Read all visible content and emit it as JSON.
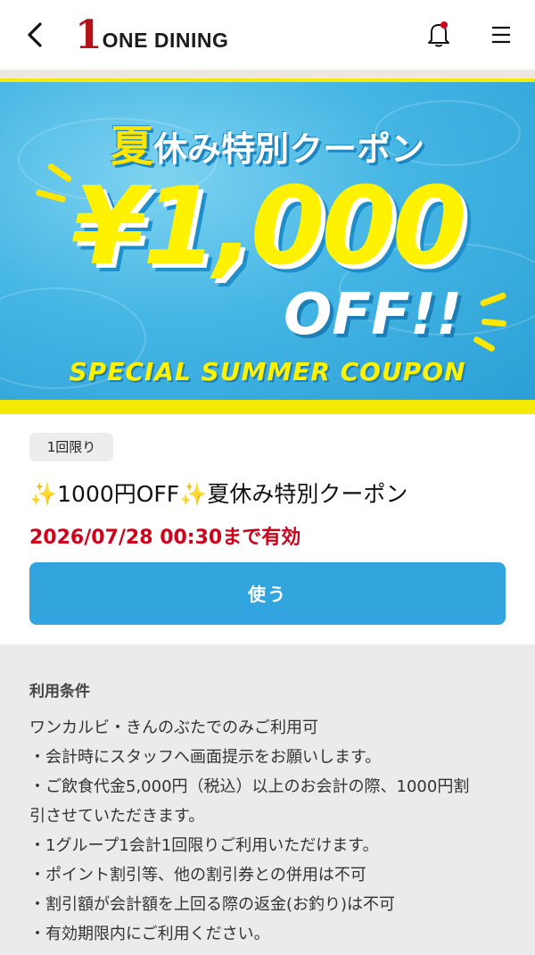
{
  "header": {
    "logo_number": "1",
    "logo_text": "ONE DINING",
    "back_icon": "chevron-left-icon",
    "bell_icon": "bell-icon",
    "menu_icon": "hamburger-menu-icon",
    "notification_dot_color": "#d0021b"
  },
  "banner": {
    "title_highlight": "夏",
    "title_rest": "休み特別クーポン",
    "amount": "¥1,000",
    "off": "OFF!!",
    "subtitle": "SPECIAL SUMMER COUPON"
  },
  "coupon": {
    "badge": "1回限り",
    "title": "✨1000円OFF✨夏休み特別クーポン",
    "valid_until": "2026/07/28 00:30まで有効",
    "use_button": "使う"
  },
  "terms": {
    "title": "利用条件",
    "lines": [
      "ワンカルビ・きんのぶたでのみご利用可",
      "・会計時にスタッフへ画面提示をお願いします。",
      "・ご飲食代金5,000円（税込）以上のお会計の際、1000円割",
      "引させていただきます。",
      "・1グループ1会計1回限りご利用いただけます。",
      "・ポイント割引等、他の割引券との併用は不可",
      "・割引額が会計額を上回る際の返金(お釣り)は不可",
      "・有効期限内にご利用ください。"
    ]
  },
  "colors": {
    "accent": "#33a5de",
    "brand": "#b3141b",
    "expiry": "#d0021b",
    "banner_yellow": "#f4ea00"
  }
}
